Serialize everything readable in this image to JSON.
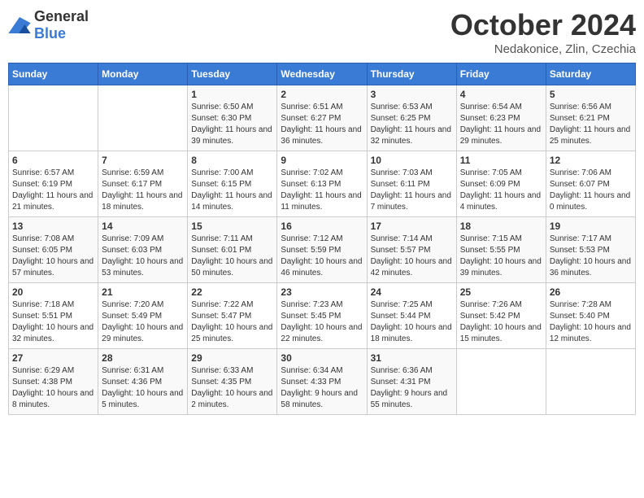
{
  "logo": {
    "general": "General",
    "blue": "Blue"
  },
  "header": {
    "month": "October 2024",
    "location": "Nedakonice, Zlin, Czechia"
  },
  "weekdays": [
    "Sunday",
    "Monday",
    "Tuesday",
    "Wednesday",
    "Thursday",
    "Friday",
    "Saturday"
  ],
  "weeks": [
    [
      {
        "day": "",
        "info": ""
      },
      {
        "day": "",
        "info": ""
      },
      {
        "day": "1",
        "info": "Sunrise: 6:50 AM\nSunset: 6:30 PM\nDaylight: 11 hours and 39 minutes."
      },
      {
        "day": "2",
        "info": "Sunrise: 6:51 AM\nSunset: 6:27 PM\nDaylight: 11 hours and 36 minutes."
      },
      {
        "day": "3",
        "info": "Sunrise: 6:53 AM\nSunset: 6:25 PM\nDaylight: 11 hours and 32 minutes."
      },
      {
        "day": "4",
        "info": "Sunrise: 6:54 AM\nSunset: 6:23 PM\nDaylight: 11 hours and 29 minutes."
      },
      {
        "day": "5",
        "info": "Sunrise: 6:56 AM\nSunset: 6:21 PM\nDaylight: 11 hours and 25 minutes."
      }
    ],
    [
      {
        "day": "6",
        "info": "Sunrise: 6:57 AM\nSunset: 6:19 PM\nDaylight: 11 hours and 21 minutes."
      },
      {
        "day": "7",
        "info": "Sunrise: 6:59 AM\nSunset: 6:17 PM\nDaylight: 11 hours and 18 minutes."
      },
      {
        "day": "8",
        "info": "Sunrise: 7:00 AM\nSunset: 6:15 PM\nDaylight: 11 hours and 14 minutes."
      },
      {
        "day": "9",
        "info": "Sunrise: 7:02 AM\nSunset: 6:13 PM\nDaylight: 11 hours and 11 minutes."
      },
      {
        "day": "10",
        "info": "Sunrise: 7:03 AM\nSunset: 6:11 PM\nDaylight: 11 hours and 7 minutes."
      },
      {
        "day": "11",
        "info": "Sunrise: 7:05 AM\nSunset: 6:09 PM\nDaylight: 11 hours and 4 minutes."
      },
      {
        "day": "12",
        "info": "Sunrise: 7:06 AM\nSunset: 6:07 PM\nDaylight: 11 hours and 0 minutes."
      }
    ],
    [
      {
        "day": "13",
        "info": "Sunrise: 7:08 AM\nSunset: 6:05 PM\nDaylight: 10 hours and 57 minutes."
      },
      {
        "day": "14",
        "info": "Sunrise: 7:09 AM\nSunset: 6:03 PM\nDaylight: 10 hours and 53 minutes."
      },
      {
        "day": "15",
        "info": "Sunrise: 7:11 AM\nSunset: 6:01 PM\nDaylight: 10 hours and 50 minutes."
      },
      {
        "day": "16",
        "info": "Sunrise: 7:12 AM\nSunset: 5:59 PM\nDaylight: 10 hours and 46 minutes."
      },
      {
        "day": "17",
        "info": "Sunrise: 7:14 AM\nSunset: 5:57 PM\nDaylight: 10 hours and 42 minutes."
      },
      {
        "day": "18",
        "info": "Sunrise: 7:15 AM\nSunset: 5:55 PM\nDaylight: 10 hours and 39 minutes."
      },
      {
        "day": "19",
        "info": "Sunrise: 7:17 AM\nSunset: 5:53 PM\nDaylight: 10 hours and 36 minutes."
      }
    ],
    [
      {
        "day": "20",
        "info": "Sunrise: 7:18 AM\nSunset: 5:51 PM\nDaylight: 10 hours and 32 minutes."
      },
      {
        "day": "21",
        "info": "Sunrise: 7:20 AM\nSunset: 5:49 PM\nDaylight: 10 hours and 29 minutes."
      },
      {
        "day": "22",
        "info": "Sunrise: 7:22 AM\nSunset: 5:47 PM\nDaylight: 10 hours and 25 minutes."
      },
      {
        "day": "23",
        "info": "Sunrise: 7:23 AM\nSunset: 5:45 PM\nDaylight: 10 hours and 22 minutes."
      },
      {
        "day": "24",
        "info": "Sunrise: 7:25 AM\nSunset: 5:44 PM\nDaylight: 10 hours and 18 minutes."
      },
      {
        "day": "25",
        "info": "Sunrise: 7:26 AM\nSunset: 5:42 PM\nDaylight: 10 hours and 15 minutes."
      },
      {
        "day": "26",
        "info": "Sunrise: 7:28 AM\nSunset: 5:40 PM\nDaylight: 10 hours and 12 minutes."
      }
    ],
    [
      {
        "day": "27",
        "info": "Sunrise: 6:29 AM\nSunset: 4:38 PM\nDaylight: 10 hours and 8 minutes."
      },
      {
        "day": "28",
        "info": "Sunrise: 6:31 AM\nSunset: 4:36 PM\nDaylight: 10 hours and 5 minutes."
      },
      {
        "day": "29",
        "info": "Sunrise: 6:33 AM\nSunset: 4:35 PM\nDaylight: 10 hours and 2 minutes."
      },
      {
        "day": "30",
        "info": "Sunrise: 6:34 AM\nSunset: 4:33 PM\nDaylight: 9 hours and 58 minutes."
      },
      {
        "day": "31",
        "info": "Sunrise: 6:36 AM\nSunset: 4:31 PM\nDaylight: 9 hours and 55 minutes."
      },
      {
        "day": "",
        "info": ""
      },
      {
        "day": "",
        "info": ""
      }
    ]
  ]
}
